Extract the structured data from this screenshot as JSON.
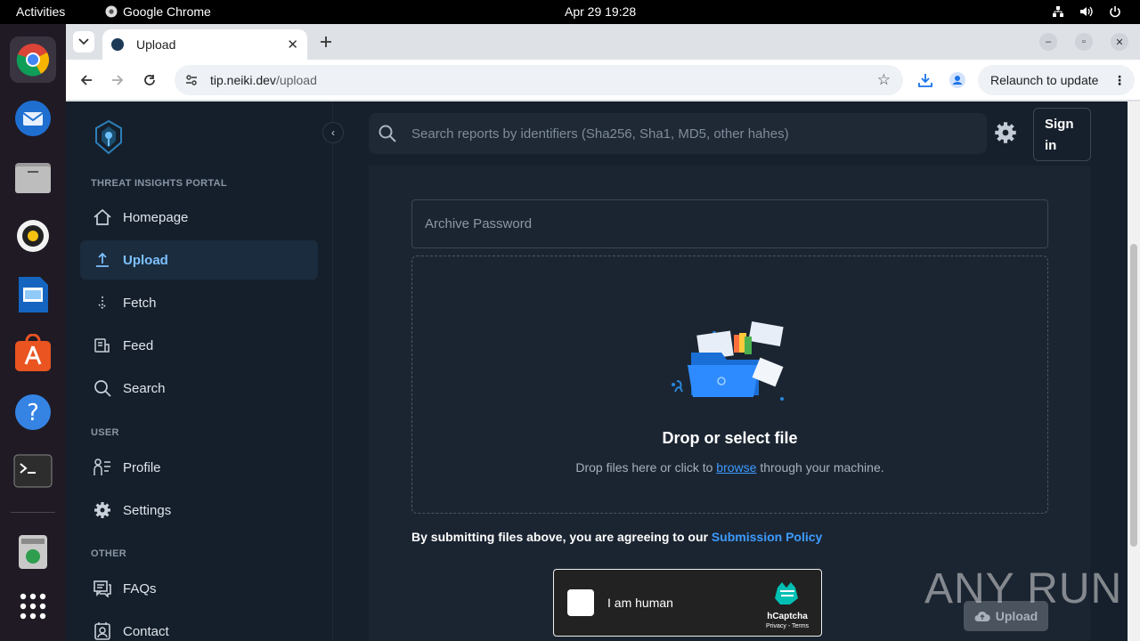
{
  "system_bar": {
    "activities": "Activities",
    "app_name": "Google Chrome",
    "clock": "Apr 29  19:28",
    "tray_icons": [
      "network-icon",
      "volume-icon",
      "power-icon"
    ]
  },
  "dock": {
    "apps": [
      "chrome",
      "thunderbird",
      "files",
      "rhythmbox",
      "libreoffice-writer",
      "app-center",
      "help",
      "terminal",
      "trash",
      "show-apps"
    ]
  },
  "browser": {
    "tab_title": "Upload",
    "url_host": "tip.neiki.dev",
    "url_path": "/upload",
    "relaunch_label": "Relaunch to update"
  },
  "sidebar": {
    "section_portal": "THREAT INSIGHTS PORTAL",
    "section_user": "USER",
    "section_other": "OTHER",
    "items": [
      {
        "label": "Homepage",
        "icon": "home-icon"
      },
      {
        "label": "Upload",
        "icon": "upload-icon",
        "active": true
      },
      {
        "label": "Fetch",
        "icon": "fetch-icon"
      },
      {
        "label": "Feed",
        "icon": "feed-icon"
      },
      {
        "label": "Search",
        "icon": "search-icon"
      },
      {
        "label": "Profile",
        "icon": "profile-icon"
      },
      {
        "label": "Settings",
        "icon": "gear-icon"
      },
      {
        "label": "FAQs",
        "icon": "faq-icon"
      },
      {
        "label": "Contact",
        "icon": "contact-icon"
      }
    ]
  },
  "header": {
    "search_placeholder": "Search reports by identifiers (Sha256, Sha1, MD5, other hahes)",
    "signin_label": "Sign in"
  },
  "upload_form": {
    "password_placeholder": "Archive Password",
    "drop_title": "Drop or select file",
    "drop_desc_before": "Drop files here or click to ",
    "drop_desc_link": "browse",
    "drop_desc_after": " through your machine.",
    "policy_text": "By submitting files above, you are agreeing to our ",
    "policy_link": "Submission Policy",
    "captcha_label": "I am human",
    "captcha_brand": "hCaptcha",
    "captcha_terms": "Privacy - Terms",
    "upload_button": "Upload"
  },
  "watermark": "ANY RUN",
  "colors": {
    "page_bg": "#16202c",
    "accent": "#3d9bff",
    "active_nav_text": "#7fc1ff"
  }
}
